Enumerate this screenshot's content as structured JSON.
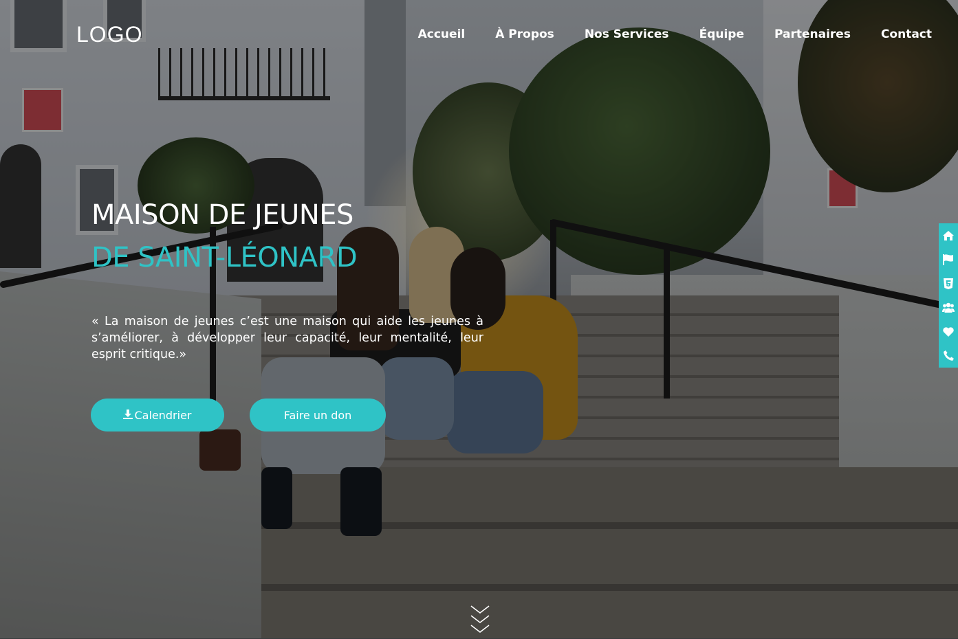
{
  "header": {
    "logo": "LOGO",
    "nav": [
      {
        "label": "Accueil"
      },
      {
        "label": "À Propos"
      },
      {
        "label": "Nos Services"
      },
      {
        "label": "Équipe"
      },
      {
        "label": "Partenaires"
      },
      {
        "label": "Contact"
      }
    ]
  },
  "hero": {
    "title": "MAISON DE JEUNES",
    "subtitle": "DE SAINT-LÉONARD",
    "quote": "« La maison de jeunes c’est une maison qui aide les jeunes à s’améliorer, à développer leur capacité, leur mentalité, leur esprit critique.»",
    "buttons": {
      "calendar": {
        "label": "Calendrier",
        "icon": "download-icon"
      },
      "donate": {
        "label": "Faire un don"
      }
    },
    "scroll_icon": "chevrons-down-icon"
  },
  "side_bar": {
    "icons": [
      "home-icon",
      "flag-icon",
      "html5-icon",
      "users-icon",
      "heart-icon",
      "phone-icon"
    ]
  },
  "colors": {
    "accent": "#2fc3c6",
    "text": "#ffffff",
    "overlay": "rgba(0,0,0,0.42)"
  }
}
